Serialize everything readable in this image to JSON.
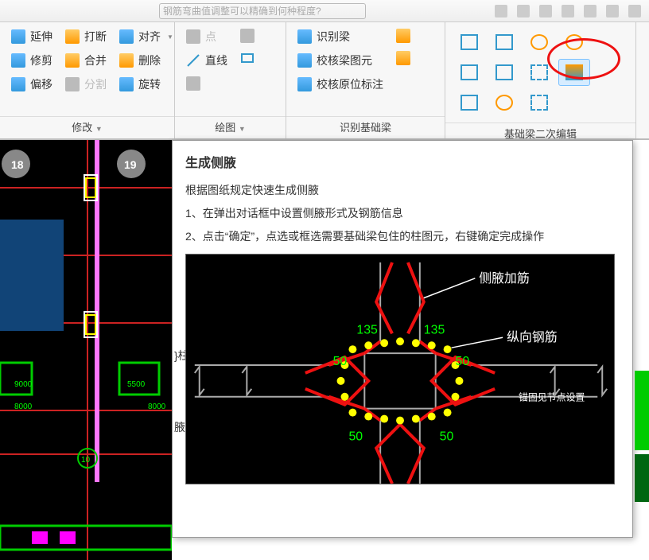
{
  "search": {
    "placeholder": "钢筋弯曲值调整可以精确到何种程度?"
  },
  "ribbon": {
    "panel_modify": {
      "title": "修改",
      "yanshen": "延伸",
      "daduan": "打断",
      "duiqi": "对齐",
      "xiujian": "修剪",
      "hebing": "合并",
      "shanchu": "删除",
      "pianyi": "偏移",
      "fenge": "分割",
      "xuanzhuan": "旋转"
    },
    "panel_draw": {
      "title": "绘图",
      "dian": "点",
      "zhixian": "直线"
    },
    "panel_beam": {
      "title": "识别基础梁",
      "shibie": "识别梁",
      "jiaoheliang": "校核梁图元",
      "jiaoheyuan": "校核原位标注"
    },
    "panel_secondary": {
      "title": "基础梁二次编辑"
    }
  },
  "tooltip": {
    "title": "生成侧腋",
    "sub": "根据图纸规定快速生成侧腋",
    "line1": "1、在弹出对话框中设置侧腋形式及钢筋信息",
    "line2": "2、点击“确定”，点选或框选需要基础梁包住的柱图元，右键确定完成操作",
    "diagram": {
      "ceyejiajin": "侧腋加筋",
      "zongxiang": "纵向钢筋",
      "n135a": "135",
      "n135b": "135",
      "n50a": "50",
      "n50b": "50",
      "n50c": "50",
      "n50d": "50",
      "maogu": "锚固见节点设置"
    },
    "sidelabel1": "}柱",
    "sidelabel2": "腋。"
  },
  "drawing": {
    "g18": "18",
    "g19": "19",
    "g10": "10",
    "d9000": "9000",
    "d5500": "5500",
    "d8000": "8000"
  }
}
